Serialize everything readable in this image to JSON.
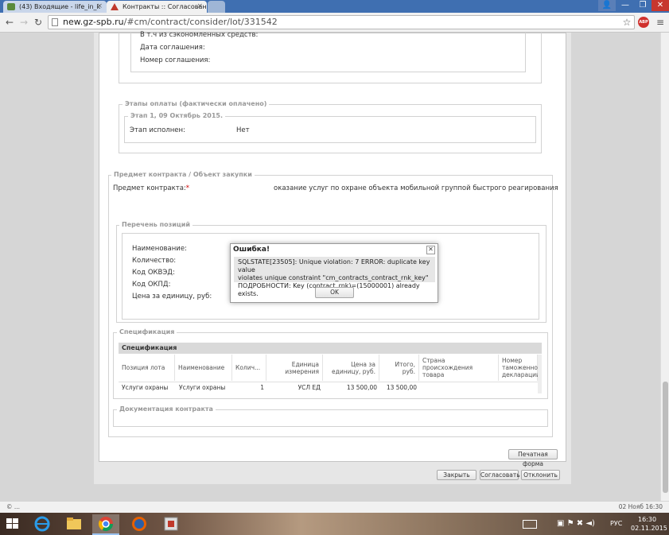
{
  "browser": {
    "tabs": [
      {
        "label": "(43) Входящие - life_in_k"
      },
      {
        "label": "Контракты :: Согласован"
      }
    ],
    "url_host": "new.gz-spb.ru",
    "url_path": "/#cm/contract/consider/lot/331542",
    "adblock_badge": "ABP"
  },
  "agreement_section": {
    "rows": [
      "В т.ч из сэкономленных средств:",
      "Дата соглашения:",
      "Номер соглашения:"
    ]
  },
  "payment_stages": {
    "legend": "Этапы оплаты (фактически оплачено)",
    "stage_legend": "Этап 1, 09 Октябрь 2015.",
    "stage_done_label": "Этап исполнен:",
    "stage_done_value": "Нет"
  },
  "subject": {
    "legend": "Предмет контракта / Объект закупки",
    "subject_label": "Предмет контракта:",
    "required_mark": "*",
    "subject_value": "оказание услуг по охране объекта мобильной группой быстрого реагирования"
  },
  "positions": {
    "legend": "Перечень позиций",
    "labels": [
      "Наименование:",
      "Количество:",
      "Код ОКВЭД:",
      "Код ОКПД:",
      "Цена за единицу, руб:"
    ]
  },
  "specification": {
    "legend": "Спецификация",
    "caption": "Спецификация",
    "columns": [
      "Позиция лота",
      "Наименование",
      "Колич...",
      "Единица измерения",
      "Цена за единицу, руб.",
      "Итого, руб.",
      "Страна происхождения товара",
      "Номер таможенной декларации"
    ],
    "rows": [
      [
        "Услуги охраны",
        "Услуги охраны",
        "1",
        "УСЛ ЕД",
        "13 500,00",
        "13 500,00",
        "",
        ""
      ]
    ]
  },
  "documentation": {
    "legend": "Документация контракта"
  },
  "buttons": {
    "print": "Печатная форма",
    "close": "Закрыть",
    "approve": "Согласовать",
    "reject": "Отклонить"
  },
  "dialog": {
    "title": "Ошибка!",
    "message_line1": "SQLSTATE[23505]: Unique violation: 7 ERROR: duplicate key value",
    "message_line2": "violates unique constraint \"cm_contracts_contract_rnk_key\"",
    "message_line3": "ПОДРОБНОСТИ: Key (contract_rnk)=(15000001) already exists.",
    "ok_label": "OK"
  },
  "status_bar": {
    "left": "© ...",
    "right": "02 Нояб 16:30"
  },
  "taskbar": {
    "language": "РУС",
    "time": "16:30",
    "date": "02.11.2015"
  }
}
